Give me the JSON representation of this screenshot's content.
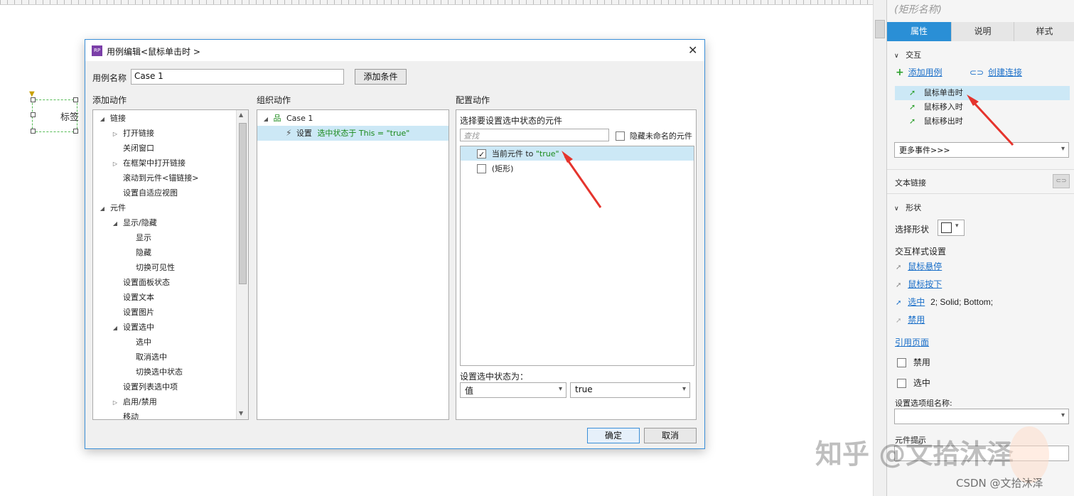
{
  "canvas": {
    "widget_label": "标签"
  },
  "dialog": {
    "title": "用例编辑<鼠标单击时 >",
    "case_name_label": "用例名称",
    "case_name_value": "Case 1",
    "add_condition": "添加条件",
    "add_action_header": "添加动作",
    "organize_header": "组织动作",
    "configure_header": "配置动作",
    "actions_tree": [
      {
        "label": "链接",
        "expanded": true
      },
      {
        "label": "打开链接",
        "collapsed": true
      },
      {
        "label": "关闭窗口"
      },
      {
        "label": "在框架中打开链接",
        "collapsed": true
      },
      {
        "label": "滚动到元件<锚链接>"
      },
      {
        "label": "设置自适应视图"
      },
      {
        "label": "元件",
        "expanded": true
      },
      {
        "label": "显示/隐藏",
        "expanded": true
      },
      {
        "label": "显示"
      },
      {
        "label": "隐藏"
      },
      {
        "label": "切换可见性"
      },
      {
        "label": "设置面板状态"
      },
      {
        "label": "设置文本"
      },
      {
        "label": "设置图片"
      },
      {
        "label": "设置选中",
        "expanded": true
      },
      {
        "label": "选中"
      },
      {
        "label": "取消选中"
      },
      {
        "label": "切换选中状态"
      },
      {
        "label": "设置列表选中项"
      },
      {
        "label": "启用/禁用",
        "collapsed": true
      },
      {
        "label": "移动"
      }
    ],
    "organize": {
      "case": "Case 1",
      "action_prefix": "设置",
      "action_detail": "选中状态于 This = \"true\""
    },
    "configure": {
      "select_prompt": "选择要设置选中状态的元件",
      "search_placeholder": "查找",
      "hide_unnamed": "隐藏未命名的元件",
      "items": [
        {
          "label": "当前元件",
          "suffix": " to ",
          "value": "\"true\"",
          "checked": true
        },
        {
          "label": "(矩形)",
          "checked": false
        }
      ],
      "set_state_label": "设置选中状态为：",
      "value_select": "值",
      "true_select": "true"
    },
    "ok": "确定",
    "cancel": "取消"
  },
  "rpane": {
    "title": "(矩形名称)",
    "tabs": [
      "属性",
      "说明",
      "样式"
    ],
    "interaction_header": "交互",
    "add_case": "添加用例",
    "create_link": "创建连接",
    "events": [
      "鼠标单击时",
      "鼠标移入时",
      "鼠标移出时"
    ],
    "more_events": "更多事件>>>",
    "text_link": "文本链接",
    "shape_header": "形状",
    "select_shape": "选择形状",
    "interaction_style": "交互样式设置",
    "mouse_hover": "鼠标悬停",
    "mouse_down": "鼠标按下",
    "selected": "选中",
    "selected_detail": "2; Solid; Bottom;",
    "disabled_link": "禁用",
    "ref_page": "引用页面",
    "disabled_cb": "禁用",
    "selected_cb": "选中",
    "group_name": "设置选项组名称:",
    "tooltip": "元件提示"
  },
  "watermark": {
    "zhihu": "知乎 @文拾沐泽",
    "csdn": "CSDN @文拾沐泽"
  },
  "colors": {
    "accent": "#2a8fd6",
    "link": "#1a6fc9",
    "green_text": "#1a8a1a",
    "arrow": "#e5342d"
  }
}
